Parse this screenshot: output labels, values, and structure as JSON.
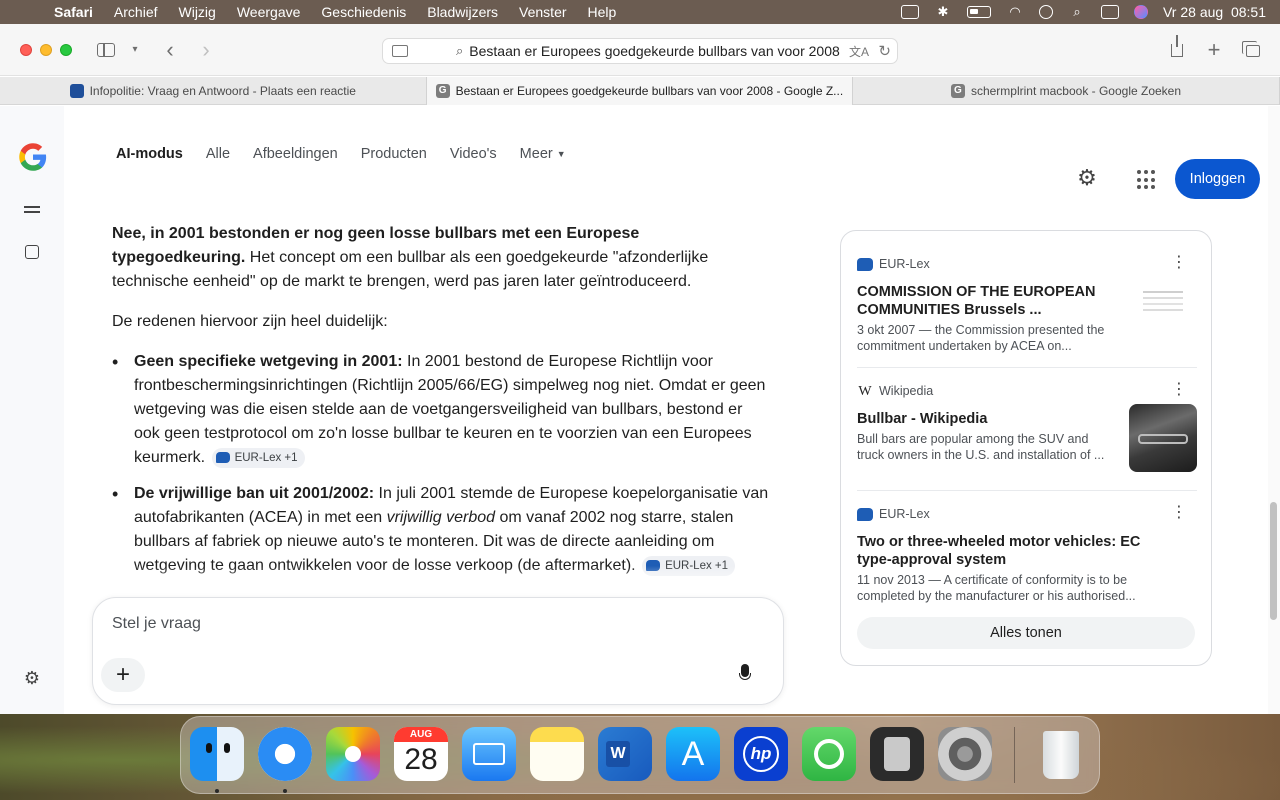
{
  "menubar": {
    "apple": "",
    "items": [
      "Safari",
      "Archief",
      "Wijzig",
      "Weergave",
      "Geschiedenis",
      "Bladwijzers",
      "Venster",
      "Help"
    ],
    "clock": "Vr 28 aug  08:51"
  },
  "browser": {
    "address": "Bestaan er Europees goedgekeurde bullbars van voor 2008",
    "tabs": [
      {
        "label": "Infopolitie: Vraag en Antwoord - Plaats een reactie",
        "favicon": "politie"
      },
      {
        "label": "Bestaan er Europees goedgekeurde bullbars van voor 2008 - Google Z...",
        "favicon": "G"
      },
      {
        "label": "schermplrint macbook - Google Zoeken",
        "favicon": "G"
      }
    ]
  },
  "google": {
    "logo": "G",
    "nav": [
      "AI-modus",
      "Alle",
      "Afbeeldingen",
      "Producten",
      "Video's",
      "Meer"
    ],
    "signin": "Inloggen"
  },
  "answer": {
    "intro_bold": "Nee, in 2001 bestonden er nog geen losse bullbars met een Europese typegoedkeuring.",
    "intro_rest": " Het concept om een bullbar als een goedgekeurde \"afzonderlijke technische eenheid\" op de markt te brengen, werd pas jaren later geïntroduceerd.",
    "reasons": "De redenen hiervoor zijn heel duidelijk:",
    "bullet1_bold": "Geen specifieke wetgeving in 2001:",
    "bullet1_text": " In 2001 bestond de Europese Richtlijn voor frontbeschermingsinrichtingen (Richtlijn 2005/66/EG) simpelweg nog niet. Omdat er geen wetgeving was die eisen stelde aan de voetgangersveiligheid van bullbars, bestond er ook geen testprotocol om zo'n losse bullbar te keuren en te voorzien van een Europees keurmerk.",
    "bullet2_bold": "De vrijwillige ban uit 2001/2002:",
    "bullet2_text_a": " In juli 2001 stemde de Europese koepelorganisatie van autofabrikanten (ACEA) in met een ",
    "bullet2_italic": "vrijwillig verbod",
    "bullet2_text_b": " om vanaf 2002 nog starre, stalen bullbars af fabriek op nieuwe auto's te monteren. Dit was de directe aanleiding om wetgeving te gaan ontwikkelen voor de losse verkoop (de aftermarket).",
    "chip": "EUR-Lex +1"
  },
  "ask": {
    "placeholder": "Stel je vraag",
    "plus": "+"
  },
  "sources": {
    "items": [
      {
        "site": "EUR-Lex",
        "title": "COMMISSION OF THE EUROPEAN COMMUNITIES Brussels ...",
        "snippet": "3 okt 2007 — the Commission presented the commitment undertaken by ACEA on..."
      },
      {
        "site": "Wikipedia",
        "title": "Bullbar - Wikipedia",
        "snippet": "Bull bars are popular among the SUV and truck owners in the U.S. and installation of ..."
      },
      {
        "site": "EUR-Lex",
        "title": "Two or three-wheeled motor vehicles: EC type-approval system",
        "snippet": "11 nov 2013 — A certificate of conformity is to be completed by the manufacturer or his authorised..."
      }
    ],
    "show_all": "Alles tonen",
    "wiki_glyph": "W"
  },
  "dock": {
    "calendar_month": "AUG",
    "calendar_day": "28",
    "word_letter": "W",
    "hp_letters": "hp",
    "appstore_glyph": "A"
  },
  "colors": {
    "google_blue": "#0b57d0",
    "eurlex_blue": "#1e5db5"
  }
}
